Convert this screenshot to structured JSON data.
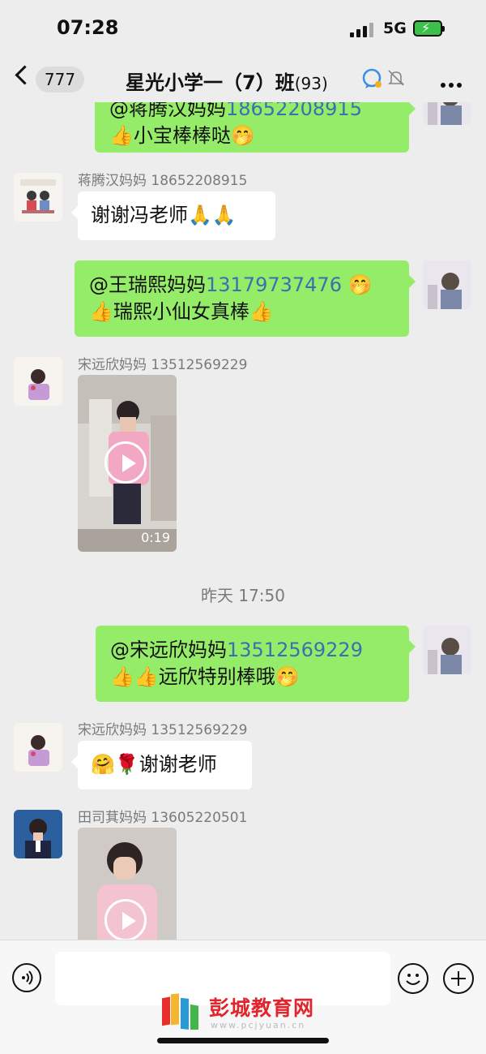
{
  "status": {
    "time": "07:28",
    "network": "5G"
  },
  "nav": {
    "unread_count": "777",
    "title": "星光小学一（7）班",
    "member_count": "(93)"
  },
  "messages": {
    "m0": {
      "line1_prefix": "@蒋腾汉妈妈",
      "line1_phone": "18652208915",
      "line2": "👍小宝棒棒哒🤭"
    },
    "m1": {
      "sender": "蒋腾汉妈妈 18652208915",
      "text": "谢谢冯老师🙏🙏"
    },
    "m2": {
      "line1_prefix": "@王瑞熙妈妈",
      "line1_phone": "13179737476",
      "line1_suffix": " 🤭",
      "line2": "👍瑞熙小仙女真棒👍"
    },
    "m3": {
      "sender": "宋远欣妈妈 13512569229",
      "duration": "0:19"
    },
    "timestamp": "昨天 17:50",
    "m4": {
      "line1_prefix": "@宋远欣妈妈",
      "line1_phone": "13512569229",
      "line2": "👍👍远欣特别棒哦🤭"
    },
    "m5": {
      "sender": "宋远欣妈妈 13512569229",
      "text": "🤗🌹谢谢老师"
    },
    "m6": {
      "sender": "田司萁妈妈 13605220501"
    }
  },
  "input": {
    "placeholder": ""
  },
  "watermark": {
    "text": "彭城教育网",
    "url": "www.pcjyuan.cn"
  },
  "colors": {
    "bubble_out": "#95ec69",
    "bubble_in": "#ffffff",
    "phone_link": "#3a6fb0",
    "background": "#ededed",
    "watermark": "#e0252d"
  }
}
